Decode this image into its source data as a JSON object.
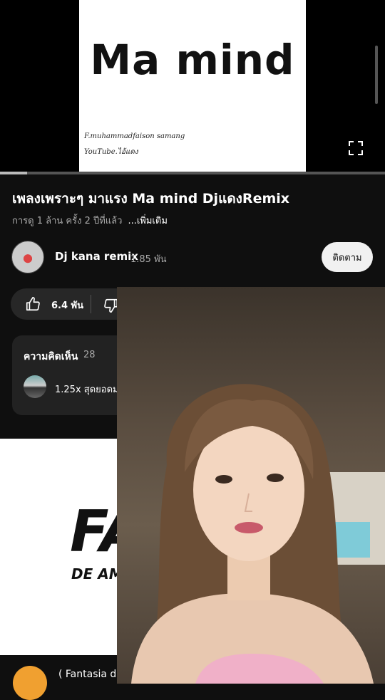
{
  "player": {
    "thumbnail_title": "Ma  mind",
    "thumbnail_credit_line1": "F.muhammadfaison samang",
    "thumbnail_credit_line2": "YouTube.ไอ้แดง",
    "progress_fraction": 0.07,
    "fullscreen_icon": "fullscreen-icon"
  },
  "video": {
    "title": "เพลงเพราะๆ มาแรง Ma mind DjแดงRemix",
    "meta": "การดู 1 ล้าน ครั้ง  2 ปีที่แล้ว",
    "more": "...เพิ่มเติม"
  },
  "channel": {
    "name": "Dj kana remix",
    "subscribers": "1.85 พัน",
    "subscribe_label": "ติดตาม"
  },
  "actions": {
    "like_count": "6.4 พัน"
  },
  "comments": {
    "label": "ความคิดเห็น",
    "count": "28",
    "top_comment": "1.25x สุดยอดม"
  },
  "next_video": {
    "thumb_text_big": "FA",
    "thumb_text_small": "DE AM",
    "title": "( Fantasia d"
  },
  "colors": {
    "background": "#0f0f0f",
    "subscribe_bg": "#f1f1f1",
    "card": "#272727"
  }
}
